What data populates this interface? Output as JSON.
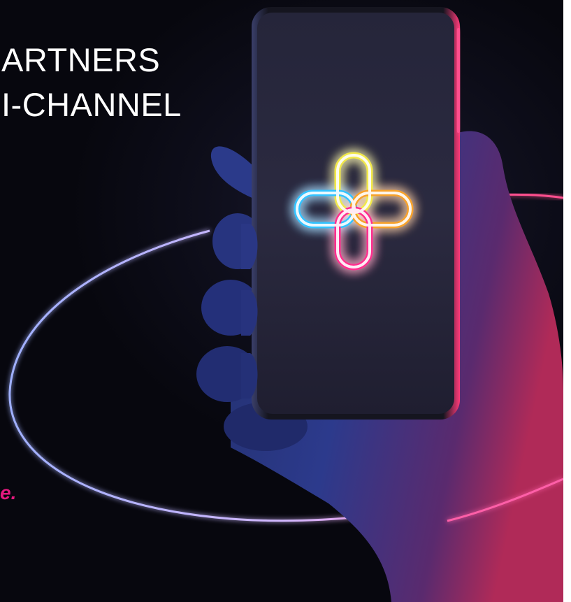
{
  "headline": {
    "line1": "ARTNERS",
    "line2": "I-CHANNEL"
  },
  "tagline": {
    "visible_end": "e."
  },
  "colors": {
    "background": "#0b0b16",
    "accent_magenta": "#e4197f",
    "logo_yellow": "#f0e23a",
    "logo_cyan": "#28b7f0",
    "logo_orange": "#f49a1e",
    "logo_pink": "#ef2a86",
    "ring_glow": "#b59cf2"
  },
  "image": {
    "subject": "hand-holding-smartphone",
    "screen_icon": "plus-logo-icon"
  }
}
